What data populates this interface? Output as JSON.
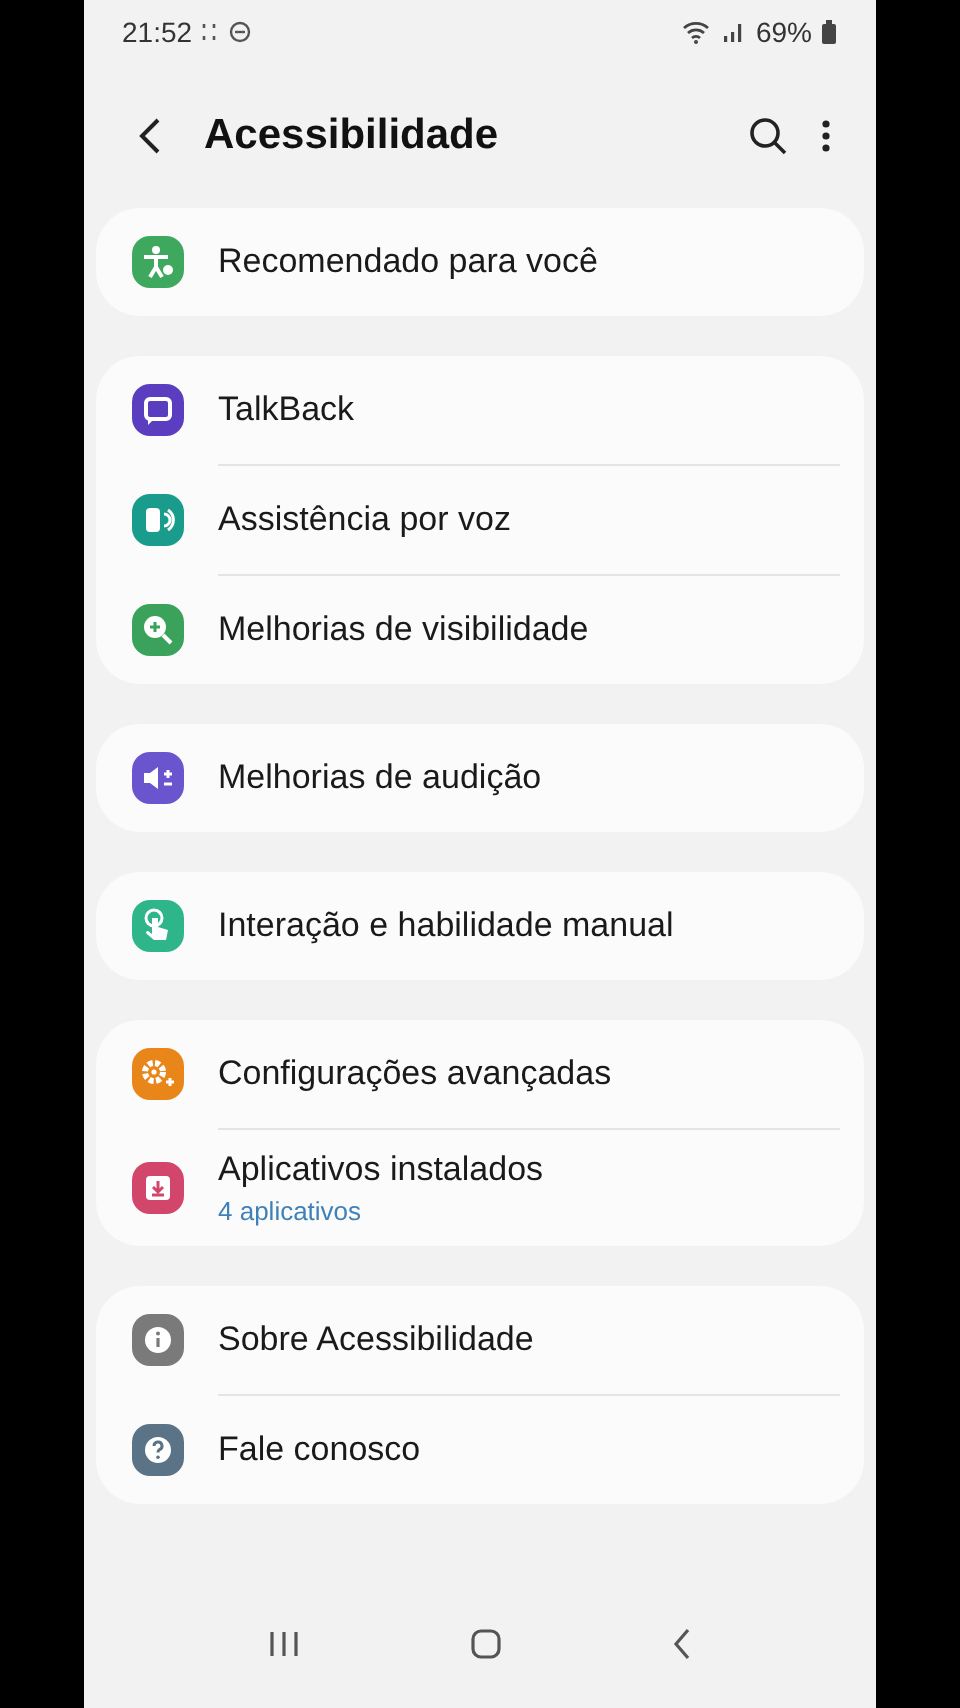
{
  "status_bar": {
    "time": "21:52",
    "battery": "69%"
  },
  "header": {
    "title": "Acessibilidade"
  },
  "groups": [
    {
      "items": [
        {
          "kind": "recommended",
          "color": "#3fa85f",
          "title": "Recomendado para você"
        }
      ]
    },
    {
      "items": [
        {
          "kind": "talkback",
          "color": "#5b3dbf",
          "title": "TalkBack"
        },
        {
          "kind": "voice",
          "color": "#1a9c8c",
          "title": "Assistência por voz"
        },
        {
          "kind": "visibility",
          "color": "#3aa25a",
          "title": "Melhorias de visibilidade"
        }
      ]
    },
    {
      "items": [
        {
          "kind": "hearing",
          "color": "#6b55cf",
          "title": "Melhorias de audição"
        }
      ]
    },
    {
      "items": [
        {
          "kind": "interaction",
          "color": "#2fb58a",
          "title": "Interação e habilidade manual"
        }
      ]
    },
    {
      "items": [
        {
          "kind": "advanced",
          "color": "#e8861a",
          "title": "Configurações avançadas"
        },
        {
          "kind": "installed",
          "color": "#d1466a",
          "title": "Aplicativos instalados",
          "subtitle": "4 aplicativos"
        }
      ]
    },
    {
      "items": [
        {
          "kind": "about",
          "color": "#7a7a7a",
          "title": "Sobre Acessibilidade"
        },
        {
          "kind": "contact",
          "color": "#5a7386",
          "title": "Fale conosco"
        }
      ]
    }
  ]
}
